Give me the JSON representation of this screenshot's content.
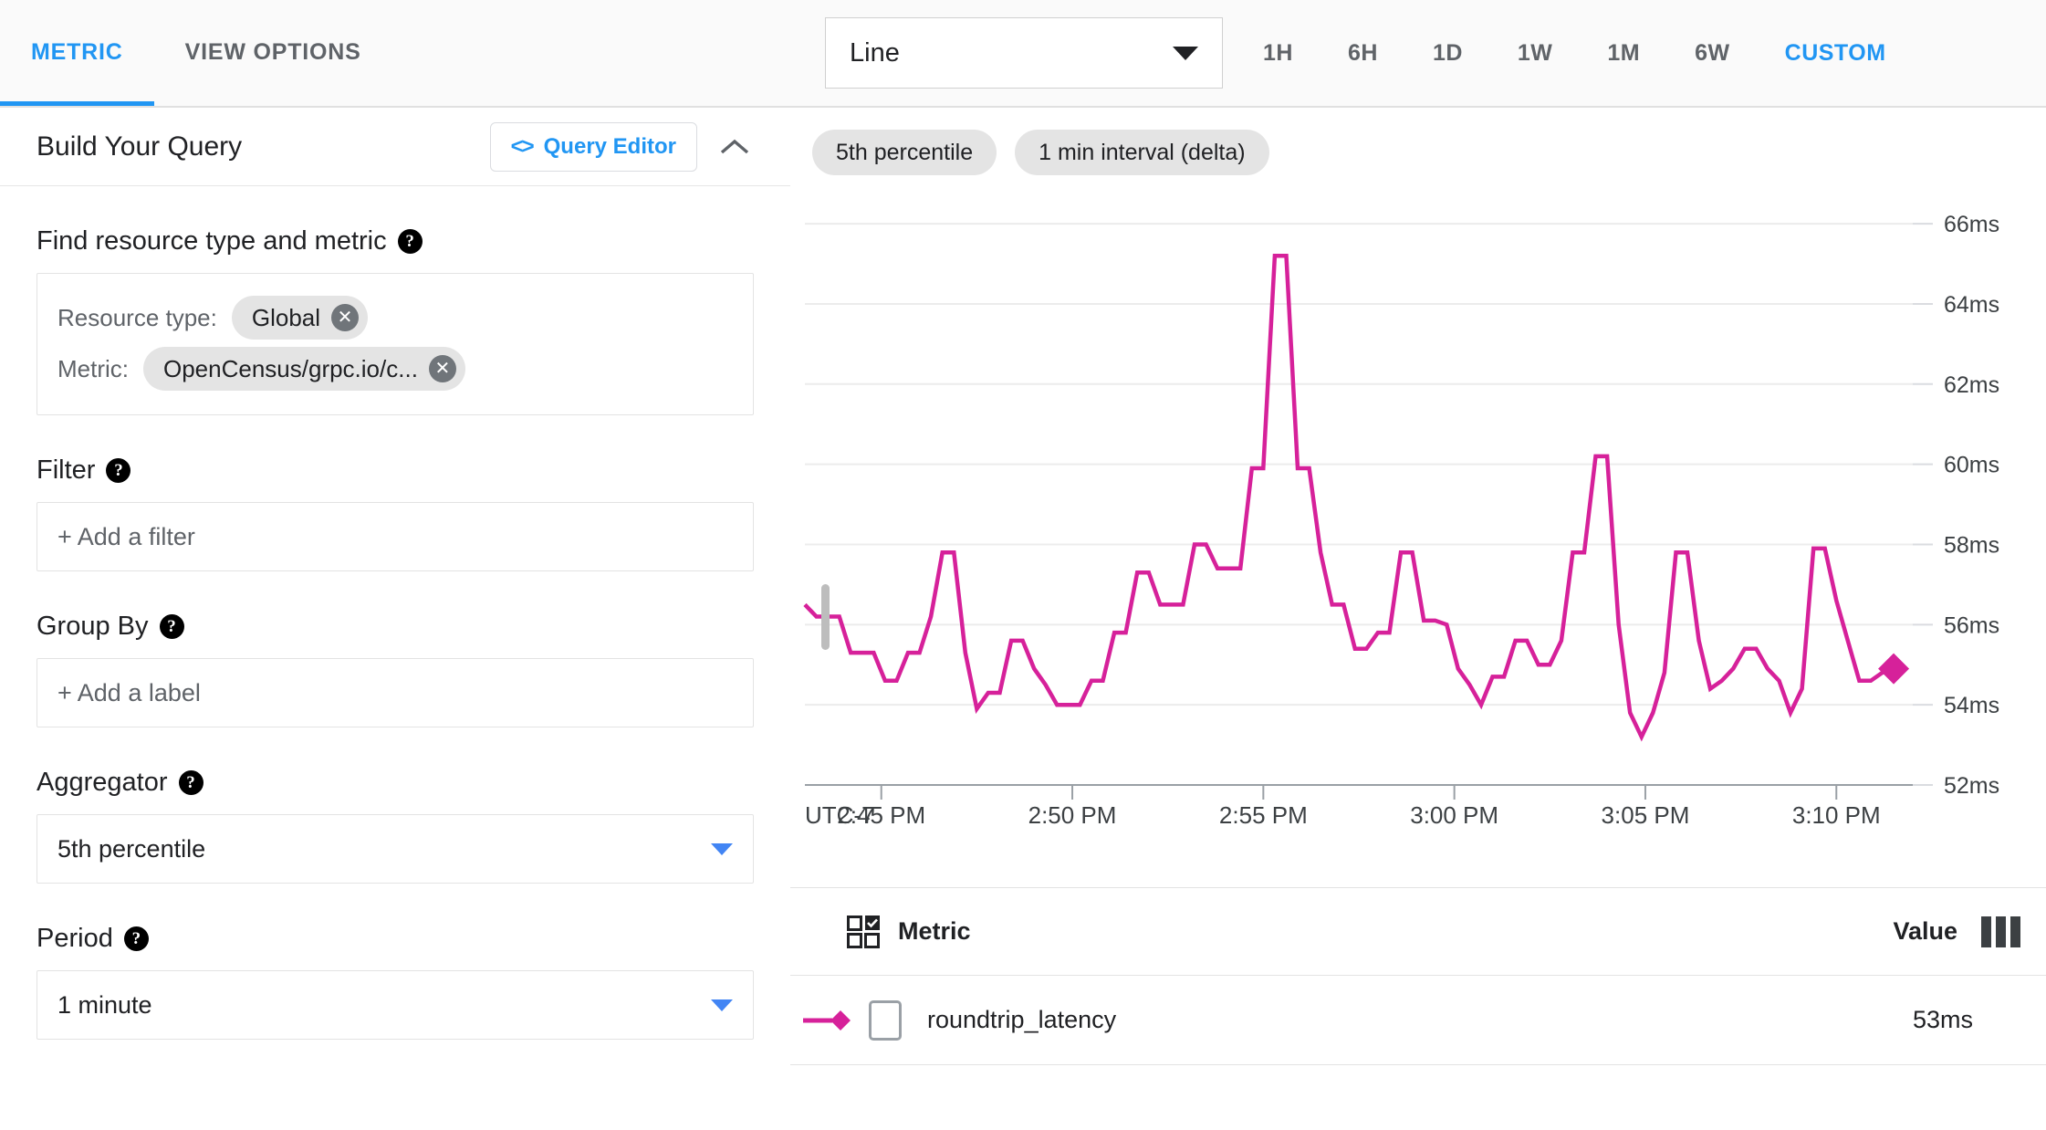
{
  "theme": {
    "accent": "#2196f3",
    "series_color": "#d6219a",
    "chip_bg": "#e4e4e4"
  },
  "left_panel": {
    "tabs": [
      {
        "label": "METRIC",
        "active": true
      },
      {
        "label": "VIEW OPTIONS",
        "active": false
      }
    ],
    "query_card": {
      "title": "Build Your Query",
      "query_editor_label": "Query Editor",
      "code_icon": "code-angle-brackets-icon",
      "collapse_icon": "chevron-up-icon"
    },
    "sections": {
      "find": {
        "label": "Find resource type and metric",
        "help_icon": "help-circle-icon",
        "resource_type_key": "Resource type:",
        "resource_type_value": "Global",
        "metric_key": "Metric:",
        "metric_value": "OpenCensus/grpc.io/c...",
        "remove_icon": "close-x-icon"
      },
      "filter": {
        "label": "Filter",
        "help_icon": "help-circle-icon",
        "placeholder": "+ Add a filter"
      },
      "group_by": {
        "label": "Group By",
        "help_icon": "help-circle-icon",
        "placeholder": "+ Add a label"
      },
      "aggregator": {
        "label": "Aggregator",
        "help_icon": "help-circle-icon",
        "value": "5th percentile",
        "caret_icon": "chevron-down-icon"
      },
      "period": {
        "label": "Period",
        "help_icon": "help-circle-icon",
        "value": "1 minute",
        "caret_icon": "chevron-down-icon"
      }
    }
  },
  "right_panel": {
    "toolbar": {
      "chart_type": "Line",
      "chart_type_caret": "chevron-down-icon",
      "ranges": [
        {
          "label": "1H",
          "active": false
        },
        {
          "label": "6H",
          "active": false
        },
        {
          "label": "1D",
          "active": false
        },
        {
          "label": "1W",
          "active": false
        },
        {
          "label": "1M",
          "active": false
        },
        {
          "label": "6W",
          "active": false
        },
        {
          "label": "CUSTOM",
          "active": true
        }
      ]
    },
    "chips": [
      {
        "label": "5th percentile"
      },
      {
        "label": "1 min interval (delta)"
      }
    ],
    "legend": {
      "select_all_icon": "grid-checkbox-icon",
      "column_metric": "Metric",
      "column_value": "Value",
      "columns_icon": "columns-icon",
      "rows": [
        {
          "series_icon": "line-diamond-marker-icon",
          "checkbox_icon": "checkbox-unchecked-icon",
          "name": "roundtrip_latency",
          "value": "53ms"
        }
      ]
    }
  },
  "chart_data": {
    "type": "line",
    "title": "",
    "xlabel": "",
    "ylabel": "",
    "timezone_label": "UTC-7",
    "grid": true,
    "legend_position": "bottom-table",
    "ylim": [
      52,
      66.8
    ],
    "ytick_labels": [
      "52ms",
      "54ms",
      "56ms",
      "58ms",
      "60ms",
      "62ms",
      "64ms",
      "66ms"
    ],
    "yticks": [
      52,
      54,
      56,
      58,
      60,
      62,
      64,
      66
    ],
    "xtick_labels": [
      "2:45 PM",
      "2:50 PM",
      "2:55 PM",
      "3:00 PM",
      "3:05 PM",
      "3:10 PM"
    ],
    "xlim": [
      163,
      192
    ],
    "xtick_values": [
      165,
      170,
      175,
      180,
      185,
      190
    ],
    "series": [
      {
        "name": "roundtrip_latency",
        "color": "#d6219a",
        "unit": "ms",
        "last_value": 53,
        "marker": "diamond-at-end",
        "x": [
          163.0,
          163.3,
          163.6,
          163.9,
          164.2,
          164.5,
          164.8,
          165.1,
          165.4,
          165.7,
          166.0,
          166.3,
          166.6,
          166.9,
          167.2,
          167.5,
          167.8,
          168.1,
          168.4,
          168.7,
          169.0,
          169.3,
          169.6,
          169.9,
          170.2,
          170.5,
          170.8,
          171.1,
          171.4,
          171.7,
          172.0,
          172.3,
          172.6,
          172.9,
          173.2,
          173.5,
          173.8,
          174.1,
          174.4,
          174.7,
          175.0,
          175.3,
          175.6,
          175.9,
          176.2,
          176.5,
          176.8,
          177.1,
          177.4,
          177.7,
          178.0,
          178.3,
          178.6,
          178.9,
          179.2,
          179.5,
          179.8,
          180.1,
          180.4,
          180.7,
          181.0,
          181.3,
          181.6,
          181.9,
          182.2,
          182.5,
          182.8,
          183.1,
          183.4,
          183.7,
          184.0,
          184.3,
          184.6,
          184.9,
          185.2,
          185.5,
          185.8,
          186.1,
          186.4,
          186.7,
          187.0,
          187.3,
          187.6,
          187.9,
          188.2,
          188.5,
          188.8,
          189.1,
          189.4,
          189.7,
          190.0,
          190.3,
          190.6,
          190.9,
          191.2,
          191.5
        ],
        "y": [
          56.5,
          56.2,
          56.2,
          56.2,
          55.3,
          55.3,
          55.3,
          54.6,
          54.6,
          55.3,
          55.3,
          56.2,
          57.8,
          57.8,
          55.3,
          53.9,
          54.3,
          54.3,
          55.6,
          55.6,
          54.9,
          54.5,
          54.0,
          54.0,
          54.0,
          54.6,
          54.6,
          55.8,
          55.8,
          57.3,
          57.3,
          56.5,
          56.5,
          56.5,
          58.0,
          58.0,
          57.4,
          57.4,
          57.4,
          59.9,
          59.9,
          65.2,
          65.2,
          59.9,
          59.9,
          57.8,
          56.5,
          56.5,
          55.4,
          55.4,
          55.8,
          55.8,
          57.8,
          57.8,
          56.1,
          56.1,
          56.0,
          54.9,
          54.5,
          54.0,
          54.7,
          54.7,
          55.6,
          55.6,
          55.0,
          55.0,
          55.6,
          57.8,
          57.8,
          60.2,
          60.2,
          56.0,
          53.8,
          53.2,
          53.8,
          54.8,
          57.8,
          57.8,
          55.6,
          54.4,
          54.6,
          54.9,
          55.4,
          55.4,
          54.9,
          54.6,
          53.8,
          54.4,
          57.9,
          57.9,
          56.6,
          55.6,
          54.6,
          54.6,
          54.8,
          54.9
        ]
      }
    ]
  }
}
